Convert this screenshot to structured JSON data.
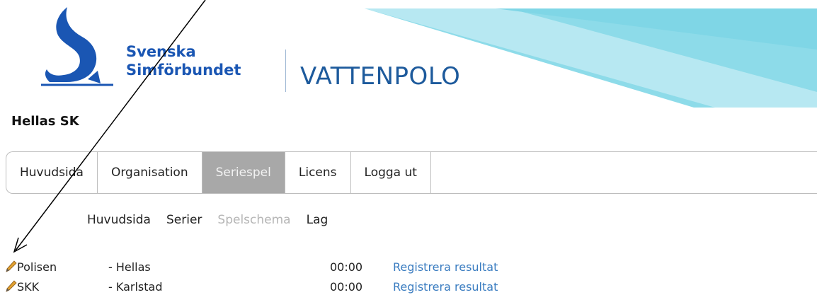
{
  "banner": {
    "brand_line1": "Svenska",
    "brand_line2": "Simförbundet",
    "app_title": "VATTENPOLO",
    "logo_icon": "swan-logo-icon",
    "accent_color": "#8ddbe9",
    "brand_color": "#1a56b3"
  },
  "club_name": "Hellas SK",
  "tabs": [
    {
      "label": "Huvudsida",
      "active": false
    },
    {
      "label": "Organisation",
      "active": false
    },
    {
      "label": "Seriespel",
      "active": true
    },
    {
      "label": "Licens",
      "active": false
    },
    {
      "label": "Logga ut",
      "active": false
    }
  ],
  "subnav": [
    {
      "label": "Huvudsida",
      "active": false
    },
    {
      "label": "Serier",
      "active": false
    },
    {
      "label": "Spelschema",
      "active": true
    },
    {
      "label": "Lag",
      "active": false
    }
  ],
  "matches": [
    {
      "home": "Polisen",
      "away": "- Hellas",
      "time": "00:00",
      "action": "Registrera resultat"
    },
    {
      "home": "SKK",
      "away": "- Karlstad",
      "time": "00:00",
      "action": "Registrera resultat"
    }
  ],
  "link_color": "#3a7cc0"
}
